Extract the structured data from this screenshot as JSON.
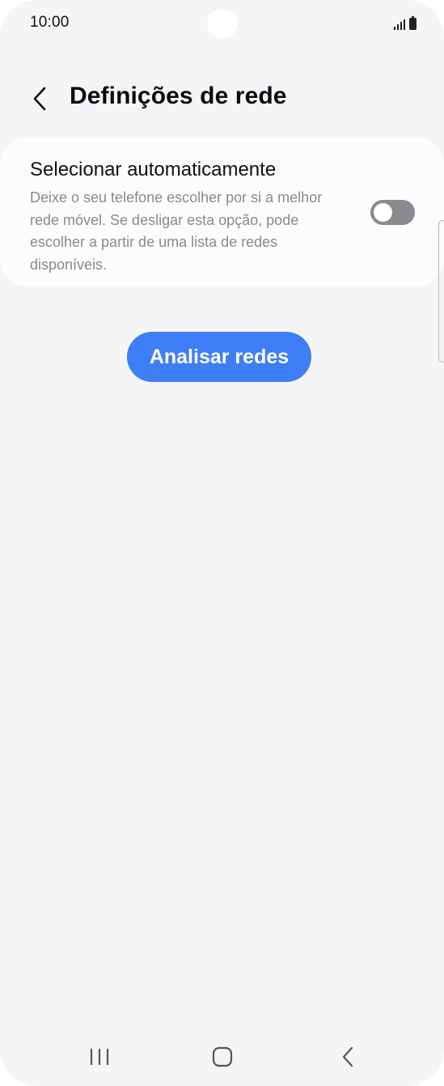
{
  "status_bar": {
    "time": "10:00",
    "icons": [
      "signal-icon",
      "battery-icon"
    ]
  },
  "header": {
    "back_icon": "chevron-left-icon",
    "title": "Definições de rede"
  },
  "auto_select": {
    "title": "Selecionar automaticamente",
    "description": "Deixe o seu telefone escolher por si a melhor rede móvel. Se desligar esta opção, pode escolher a partir de uma lista de redes disponíveis.",
    "toggle_on": false
  },
  "actions": {
    "scan_label": "Analisar redes"
  },
  "nav_bar": {
    "recents_icon": "recents-icon",
    "home_icon": "home-icon",
    "back_icon": "back-icon"
  },
  "colors": {
    "background": "#f5f5f8",
    "card": "#fcfcfe",
    "accent": "#3d7ef7",
    "toggle_off": "#8a8a8e"
  }
}
